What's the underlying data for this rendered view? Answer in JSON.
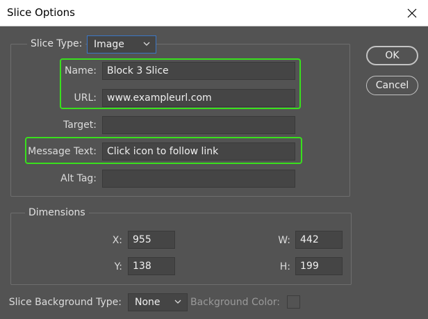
{
  "window": {
    "title": "Slice Options"
  },
  "slice": {
    "type_label": "Slice Type:",
    "type_value": "Image",
    "name_label": "Name:",
    "name_value": "Block 3 Slice",
    "url_label": "URL:",
    "url_value": "www.exampleurl.com",
    "target_label": "Target:",
    "target_value": "",
    "message_label": "Message Text:",
    "message_value": "Click icon to follow link",
    "alt_label": "Alt Tag:",
    "alt_value": ""
  },
  "dimensions": {
    "legend": "Dimensions",
    "x_label": "X:",
    "x_value": "955",
    "y_label": "Y:",
    "y_value": "138",
    "w_label": "W:",
    "w_value": "442",
    "h_label": "H:",
    "h_value": "199"
  },
  "background": {
    "type_label": "Slice Background Type:",
    "type_value": "None",
    "color_label": "Background Color:"
  },
  "buttons": {
    "ok": "OK",
    "cancel": "Cancel"
  },
  "colors": {
    "highlight": "#39e01d",
    "dialog_bg": "#535353",
    "field_bg": "#454545"
  }
}
